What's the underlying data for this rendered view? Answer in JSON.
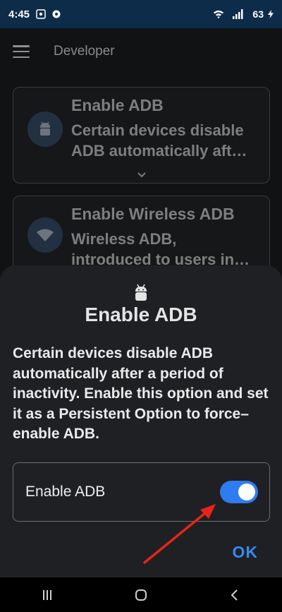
{
  "status_bar": {
    "time": "4:45",
    "battery_percent": "63"
  },
  "app_bar": {
    "title": "Developer",
    "icons": {
      "menu": "hamburger-menu-icon"
    }
  },
  "cards": [
    {
      "title": "Enable ADB",
      "description_lines": [
        "Certain devices disable",
        "ADB automatically aft…"
      ],
      "icon": "android-icon"
    },
    {
      "title": "Enable Wireless ADB",
      "description_lines": [
        "Wireless ADB,",
        "introduced to users in…"
      ],
      "icon": "wifi-icon"
    }
  ],
  "dialog": {
    "title": "Enable ADB",
    "description": "Certain devices disable ADB automatically after a period of inactivity. Enable this option and set it as a Persistent Option to force–enable ADB.",
    "toggle_label": "Enable ADB",
    "toggle_on": true,
    "ok_label": "OK"
  },
  "colors": {
    "accent": "#2f7bf0",
    "ok_text": "#3a88f2",
    "status_bar_bg": "#0d2c4a",
    "annotation_arrow": "#e8231c"
  }
}
